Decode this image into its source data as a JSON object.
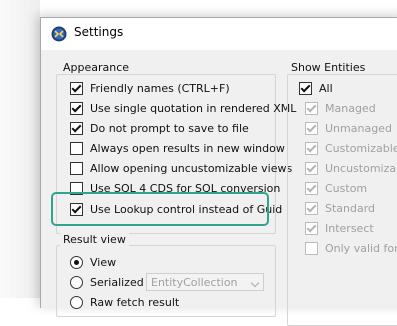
{
  "window": {
    "title": "Settings"
  },
  "appearance": {
    "legend": "Appearance",
    "items": [
      {
        "label": "Friendly names (CTRL+F)",
        "checked": true
      },
      {
        "label": "Use single quotation in rendered XML",
        "checked": true
      },
      {
        "label": "Do not prompt to save to file",
        "checked": true
      },
      {
        "label": "Always open results in new window",
        "checked": false
      },
      {
        "label": "Allow opening uncustomizable views",
        "checked": false
      },
      {
        "label": "Use SQL 4 CDS for SQL conversion",
        "checked": false
      },
      {
        "label": "Use Lookup control instead of Guid",
        "checked": true
      }
    ]
  },
  "result_view": {
    "legend": "Result view",
    "options": [
      {
        "label": "View",
        "selected": true
      },
      {
        "label": "Serialized",
        "selected": false
      },
      {
        "label": "Raw fetch result",
        "selected": false
      }
    ],
    "serialized_combo_value": "EntityCollection"
  },
  "show_entities": {
    "legend": "Show Entities",
    "items": [
      {
        "label": "All",
        "checked": true,
        "enabled": true
      },
      {
        "label": "Managed",
        "checked": true,
        "enabled": false
      },
      {
        "label": "Unmanaged",
        "checked": true,
        "enabled": false
      },
      {
        "label": "Customizable",
        "checked": true,
        "enabled": false
      },
      {
        "label": "Uncustomizable",
        "checked": true,
        "enabled": false
      },
      {
        "label": "Custom",
        "checked": true,
        "enabled": false
      },
      {
        "label": "Standard",
        "checked": true,
        "enabled": false
      },
      {
        "label": "Intersect",
        "checked": true,
        "enabled": false
      },
      {
        "label": "Only valid for Ad",
        "checked": false,
        "enabled": false
      }
    ]
  },
  "colors": {
    "highlight": "#2ea58d",
    "disabled_text": "#a0a0a0"
  }
}
